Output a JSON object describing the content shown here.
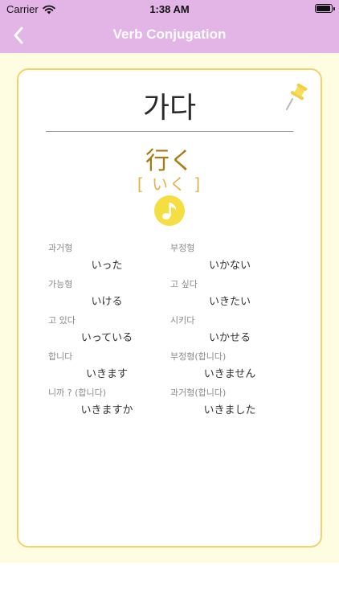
{
  "status_bar": {
    "carrier": "Carrier",
    "time": "1:38 AM",
    "battery_level": 0.95
  },
  "nav": {
    "title": "Verb Conjugation",
    "back_icon": "chevron-left-icon"
  },
  "colors": {
    "nav_background": "#e3b5e7",
    "content_background": "#fefde2",
    "card_border": "#f2d36b",
    "kanji": "#a87a10",
    "reading": "#e3b24a",
    "audio_button": "#f4de42"
  },
  "verb": {
    "korean": "가다",
    "kanji": "行く",
    "reading": "[ いく ]",
    "pin_icon": "pushpin-icon",
    "audio_icon": "music-note-icon"
  },
  "conjugations": [
    {
      "label": "과거형",
      "value": "いった"
    },
    {
      "label": "부정형",
      "value": "いかない"
    },
    {
      "label": "가능형",
      "value": "いける"
    },
    {
      "label": "고 싶다",
      "value": "いきたい"
    },
    {
      "label": "고 있다",
      "value": "いっている"
    },
    {
      "label": "시키다",
      "value": "いかせる"
    },
    {
      "label": "합니다",
      "value": "いきます"
    },
    {
      "label": "부정형(합니다)",
      "value": "いきません"
    },
    {
      "label": "니까 ? (합니다)",
      "value": "いきますか"
    },
    {
      "label": "과거형(합니다)",
      "value": "いきました"
    }
  ]
}
